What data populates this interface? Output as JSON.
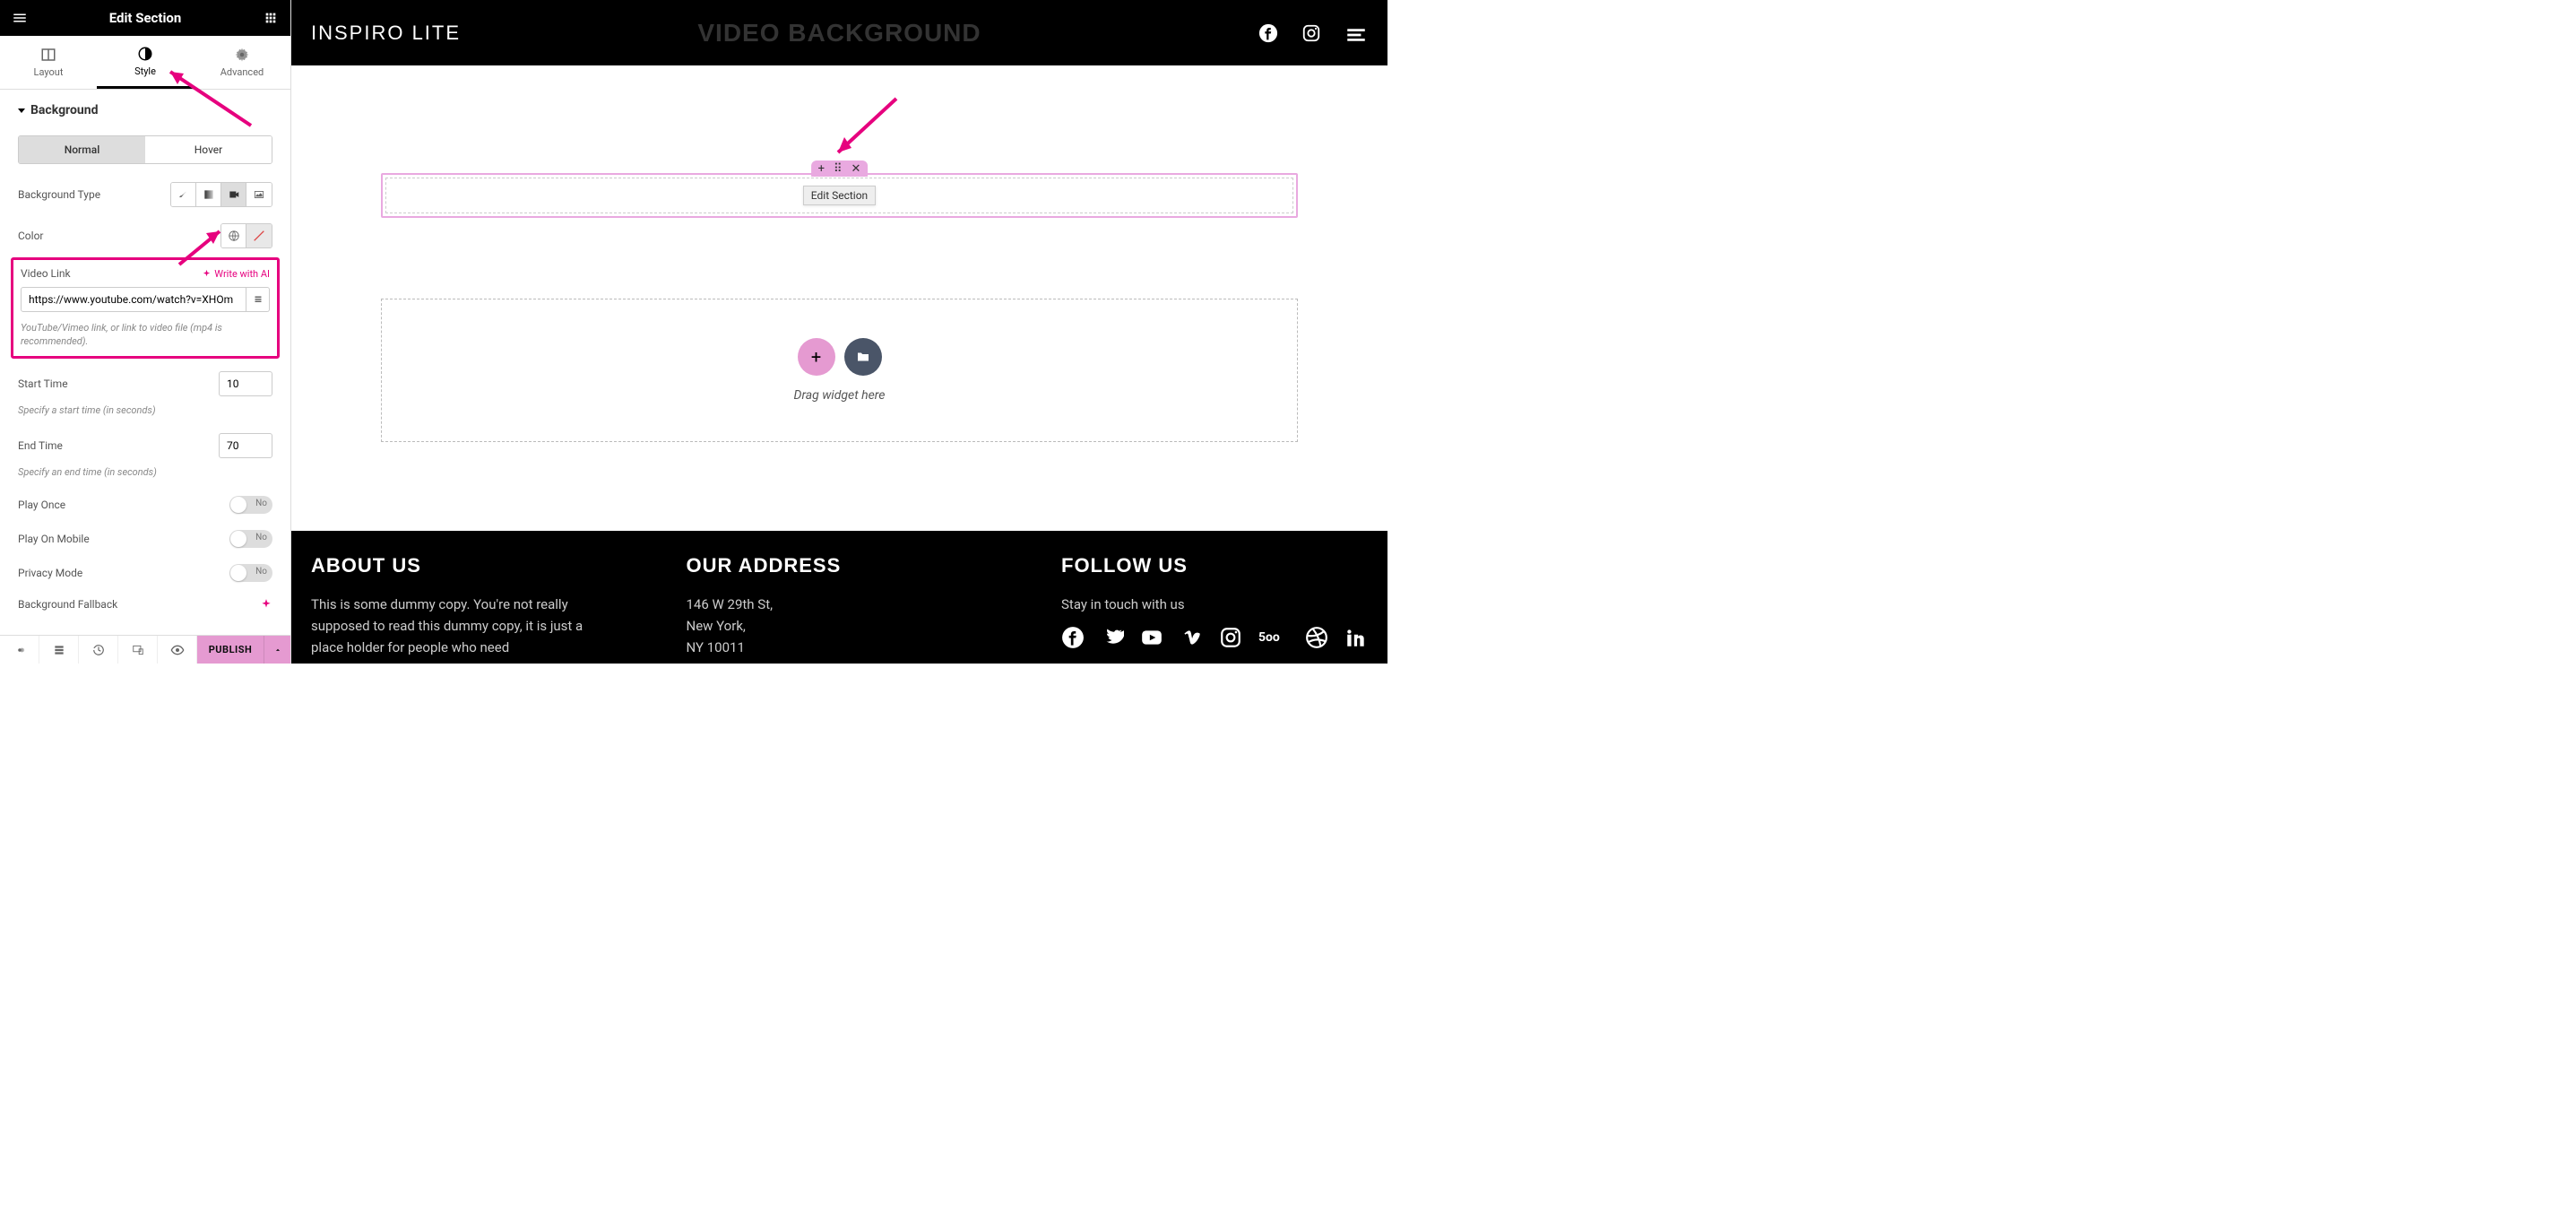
{
  "sidebar": {
    "title": "Edit Section",
    "tabs": {
      "layout": "Layout",
      "style": "Style",
      "advanced": "Advanced"
    },
    "section": "Background",
    "states": {
      "normal": "Normal",
      "hover": "Hover"
    },
    "bg_type_label": "Background Type",
    "color_label": "Color",
    "video_link_label": "Video Link",
    "write_ai": "Write with AI",
    "video_link_value": "https://www.youtube.com/watch?v=XHOm",
    "video_link_help": "YouTube/Vimeo link, or link to video file (mp4 is recommended).",
    "start_time_label": "Start Time",
    "start_time_value": "10",
    "start_time_help": "Specify a start time (in seconds)",
    "end_time_label": "End Time",
    "end_time_value": "70",
    "end_time_help": "Specify an end time (in seconds)",
    "play_once_label": "Play Once",
    "play_mobile_label": "Play On Mobile",
    "privacy_label": "Privacy Mode",
    "fallback_label": "Background Fallback",
    "toggle_off": "No",
    "publish": "PUBLISH"
  },
  "canvas": {
    "logo": "INSPIRO LITE",
    "page_title": "VIDEO BACKGROUND",
    "edit_tooltip": "Edit Section",
    "drop_text": "Drag widget here"
  },
  "footer": {
    "about_title": "ABOUT US",
    "about_text": "This is some dummy copy. You're not really supposed to read this dummy copy, it is just a place holder for people who need",
    "address_title": "OUR ADDRESS",
    "address_line1": "146 W 29th St,",
    "address_line2": "New York,",
    "address_line3": "NY 10011",
    "follow_title": "FOLLOW US",
    "follow_text": "Stay in touch with us"
  }
}
